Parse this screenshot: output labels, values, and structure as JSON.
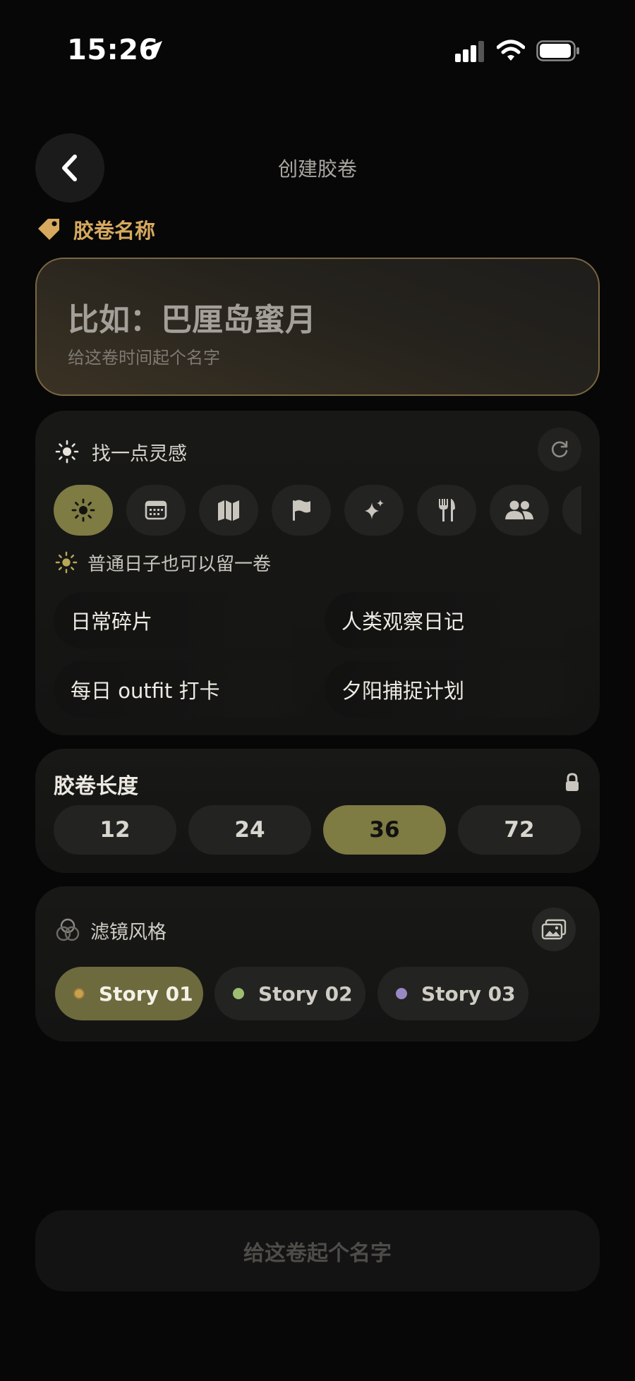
{
  "status_bar": {
    "time": "15:26"
  },
  "header": {
    "title": "创建胶卷"
  },
  "name_section": {
    "label": "胶卷名称",
    "placeholder": "比如：巴厘岛蜜月",
    "hint": "给这卷时间起个名字"
  },
  "inspiration": {
    "title": "找一点灵感",
    "categories": [
      "sun-icon",
      "calendar-icon",
      "map-icon",
      "flag-icon",
      "sparkles-icon",
      "utensils-icon",
      "people-icon",
      "more"
    ],
    "active_category_index": 0,
    "category_description": "普通日子也可以留一卷",
    "suggestions": [
      "日常碎片",
      "人类观察日记",
      "每日 outfit 打卡",
      "夕阳捕捉计划"
    ]
  },
  "film_length": {
    "title": "胶卷长度",
    "options": [
      "12",
      "24",
      "36",
      "72"
    ],
    "selected": "36"
  },
  "filter_style": {
    "title": "滤镜风格",
    "options": [
      {
        "label": "Story 01",
        "color": "#c9a04e"
      },
      {
        "label": "Story 02",
        "color": "#9fbd72"
      },
      {
        "label": "Story 03",
        "color": "#9a88c4"
      }
    ],
    "selected": "Story 01"
  },
  "cta": {
    "label": "给这卷起个名字"
  },
  "colors": {
    "accent_gold": "#d6a95f",
    "accent_olive": "#7e7b43",
    "background": "#070707"
  }
}
